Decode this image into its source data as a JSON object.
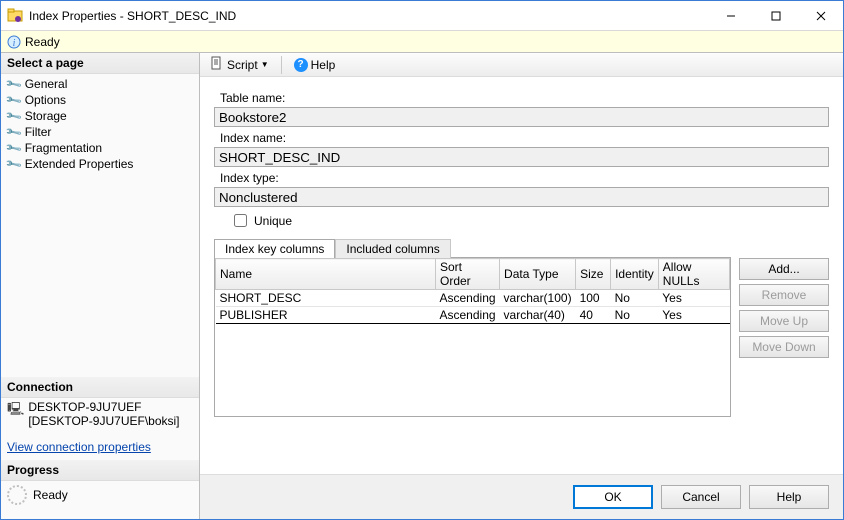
{
  "window": {
    "title": "Index Properties - SHORT_DESC_IND"
  },
  "status": {
    "text": "Ready"
  },
  "sidebar": {
    "select_heading": "Select a page",
    "pages": [
      {
        "label": "General"
      },
      {
        "label": "Options"
      },
      {
        "label": "Storage"
      },
      {
        "label": "Filter"
      },
      {
        "label": "Fragmentation"
      },
      {
        "label": "Extended Properties"
      }
    ],
    "connection_heading": "Connection",
    "server": "DESKTOP-9JU7UEF",
    "user": "[DESKTOP-9JU7UEF\\boksi]",
    "view_conn_link": "View connection properties",
    "progress_heading": "Progress",
    "progress_text": "Ready"
  },
  "toolbar": {
    "script": "Script",
    "help": "Help"
  },
  "form": {
    "table_name_lbl": "Table name:",
    "table_name": "Bookstore2",
    "index_name_lbl": "Index name:",
    "index_name": "SHORT_DESC_IND",
    "index_type_lbl": "Index type:",
    "index_type": "Nonclustered",
    "unique_lbl": "Unique",
    "unique_checked": false
  },
  "tabs": {
    "key": "Index key columns",
    "included": "Included columns"
  },
  "columns": {
    "headers": {
      "name": "Name",
      "sort": "Sort Order",
      "dt": "Data Type",
      "size": "Size",
      "ident": "Identity",
      "nulls": "Allow NULLs"
    },
    "rows": [
      {
        "name": "SHORT_DESC",
        "sort": "Ascending",
        "dt": "varchar(100)",
        "size": "100",
        "ident": "No",
        "nulls": "Yes"
      },
      {
        "name": "PUBLISHER",
        "sort": "Ascending",
        "dt": "varchar(40)",
        "size": "40",
        "ident": "No",
        "nulls": "Yes"
      }
    ]
  },
  "side_buttons": {
    "add": "Add...",
    "remove": "Remove",
    "moveup": "Move Up",
    "movedown": "Move Down"
  },
  "footer": {
    "ok": "OK",
    "cancel": "Cancel",
    "help": "Help"
  }
}
